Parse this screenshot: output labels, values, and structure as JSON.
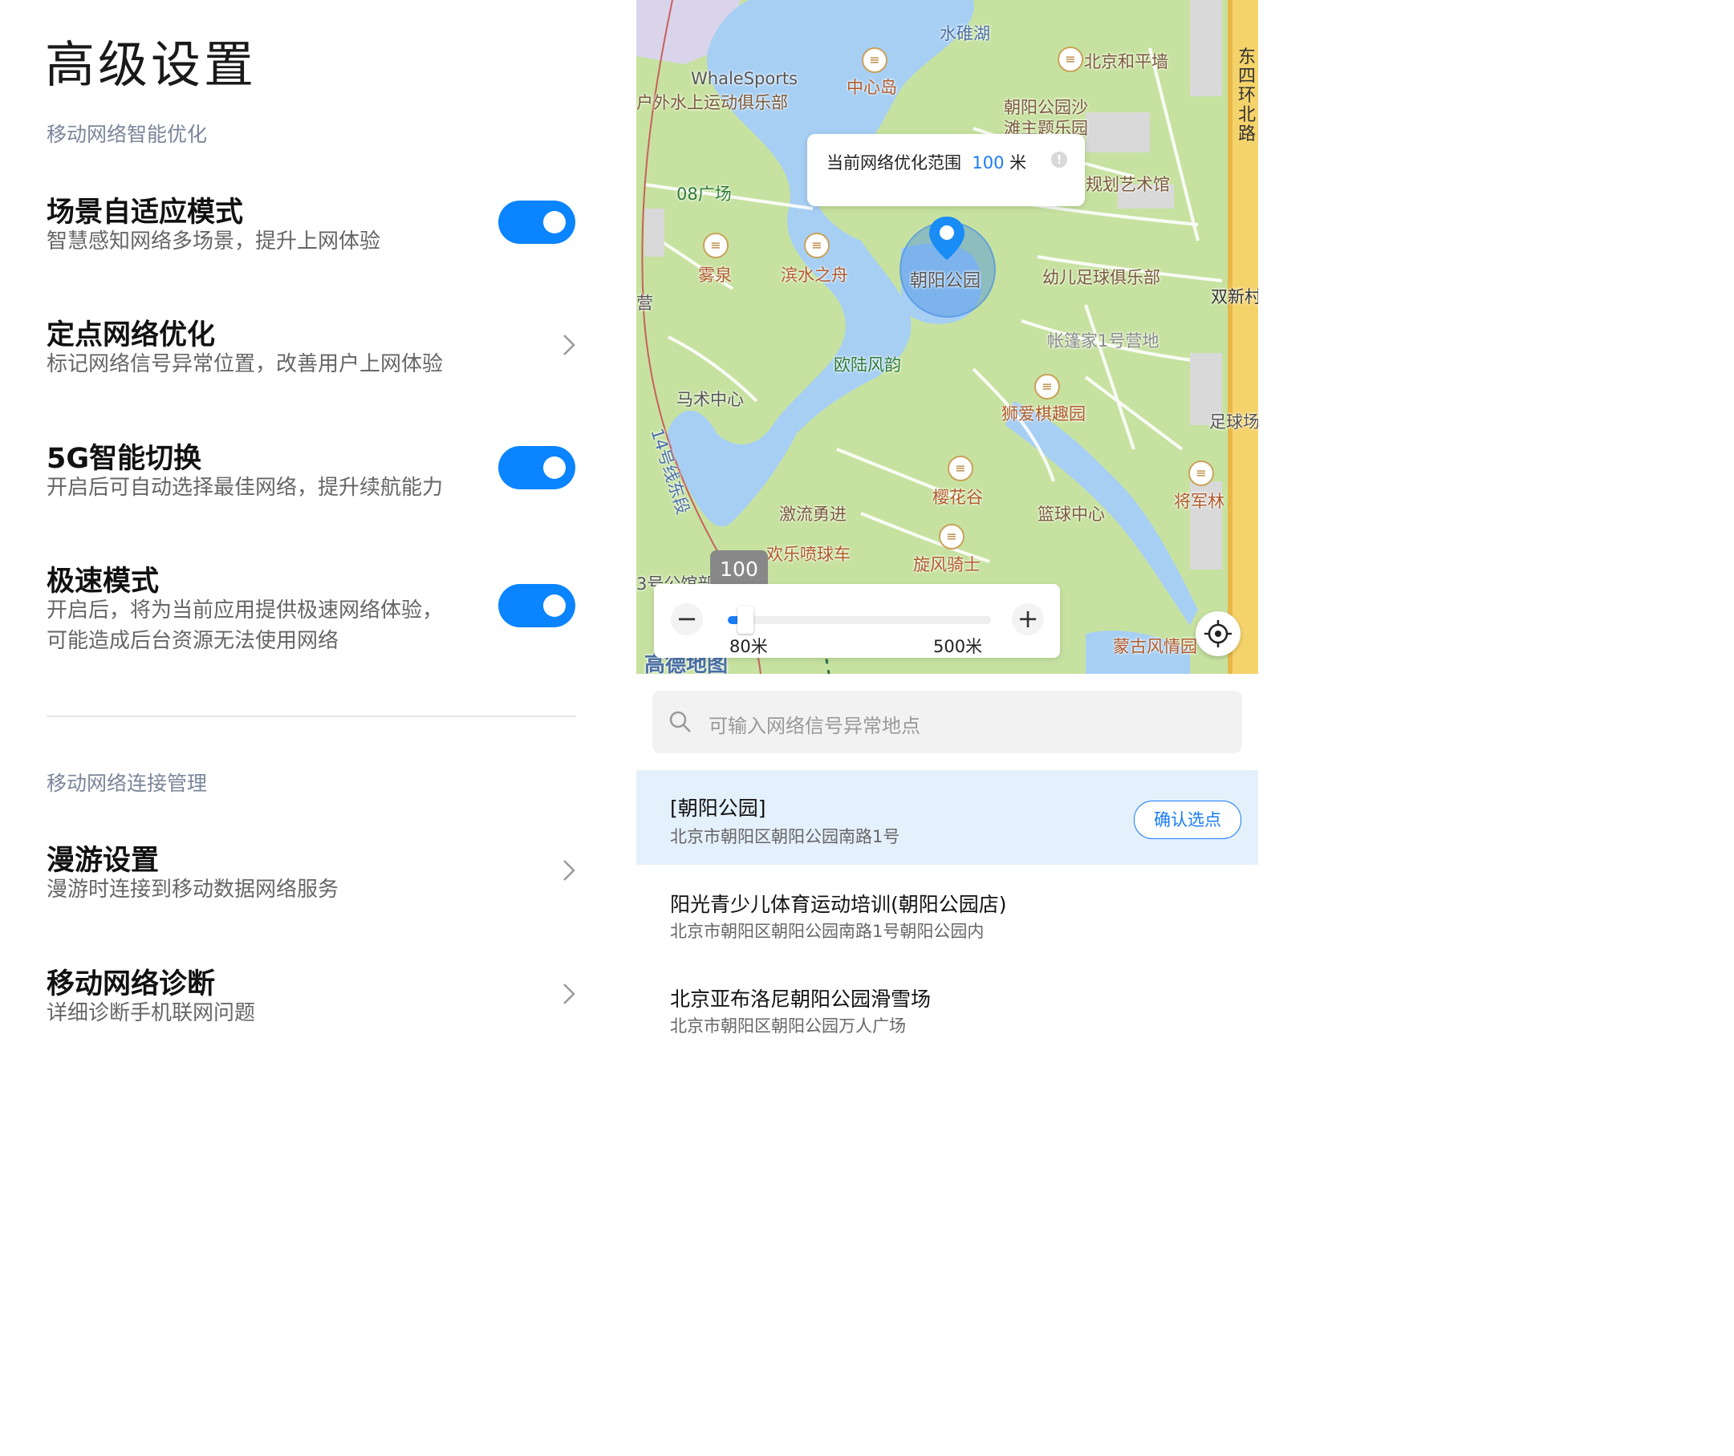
{
  "title": "高级设置",
  "sections": [
    {
      "header": "移动网络智能优化",
      "items": [
        {
          "title": "场景自适应模式",
          "subtitle": "智慧感知网络多场景，提升上网体验",
          "control": "toggle",
          "on": true
        },
        {
          "title": "定点网络优化",
          "subtitle": "标记网络信号异常位置，改善用户上网体验",
          "control": "chevron"
        },
        {
          "title": "5G智能切换",
          "subtitle": "开启后可自动选择最佳网络，提升续航能力",
          "control": "toggle",
          "on": true
        },
        {
          "title": "极速模式",
          "subtitle_line1": "开启后，将为当前应用提供极速网络体验，",
          "subtitle_line2": "可能造成后台资源无法使用网络",
          "control": "toggle",
          "on": true
        }
      ]
    },
    {
      "header": "移动网络连接管理",
      "items": [
        {
          "title": "漫游设置",
          "subtitle": "漫游时连接到移动数据网络服务",
          "control": "chevron"
        },
        {
          "title": "移动网络诊断",
          "subtitle": "详细诊断手机联网问题",
          "control": "chevron"
        }
      ]
    }
  ],
  "map": {
    "bubble": {
      "prefix": "当前网络优化范围",
      "value": "100",
      "unit": "米"
    },
    "pin_label": "朝阳公园",
    "pois": {
      "p1": "水碓湖",
      "p2": "北京和平墙",
      "p3": "WhaleSports",
      "p4": "中心岛",
      "p5": "户外水上运动俱乐部",
      "p6": "朝阳公园沙",
      "p7": "滩主题乐园",
      "p8": "08广场",
      "p9": "规划艺术馆",
      "p10": "雾泉",
      "p11": "滨水之舟",
      "p12": "幼儿足球俱乐部",
      "p13": "双新村",
      "p14": "帐篷家1号营地",
      "p15": "欧陆风韵",
      "p16": "马术中心",
      "p17": "狮爱棋趣园",
      "p18": "足球场",
      "p19": "14号线东段",
      "p20": "樱花谷",
      "p21": "激流勇进",
      "p22": "篮球中心",
      "p23": "将军林",
      "p24": "欢乐喷球车",
      "p25": "旋风骑士",
      "p26": "蒙古风情园",
      "p27": "东四环北路",
      "p28": "高德地图",
      "p29": "3号公馆部",
      "p30": "营"
    },
    "slider": {
      "value": "100",
      "min_label": "80米",
      "max_label": "500米",
      "minus": "−",
      "plus": "+",
      "fraction": 0.05
    }
  },
  "search": {
    "placeholder": "可输入网络信号异常地点"
  },
  "results": [
    {
      "name": "[朝阳公园]",
      "address": "北京市朝阳区朝阳公园南路1号",
      "selected": true,
      "action": "确认选点"
    },
    {
      "name": "阳光青少儿体育运动培训(朝阳公园店)",
      "address": "北京市朝阳区朝阳公园南路1号朝阳公园内"
    },
    {
      "name": "北京亚布洛尼朝阳公园滑雪场",
      "address": "北京市朝阳区朝阳公园万人广场"
    }
  ],
  "colors": {
    "accent": "#0a84ff",
    "selected_row": "#e4f0fb",
    "map_water": "#a9d0f5",
    "map_land": "#c9e3a2"
  }
}
